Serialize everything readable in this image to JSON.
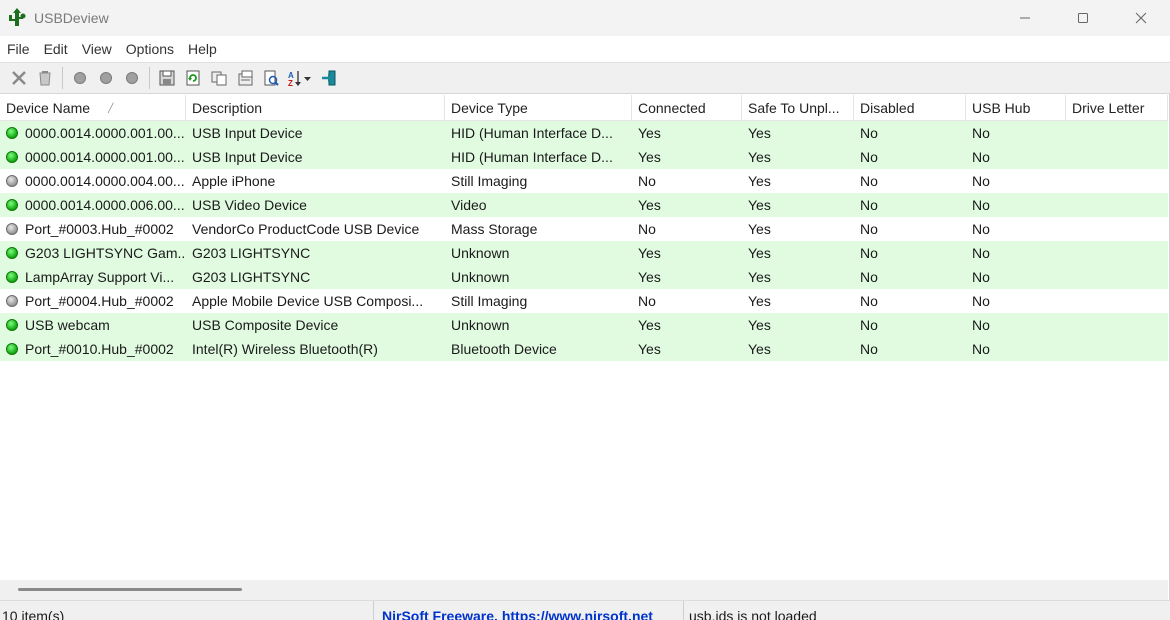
{
  "window": {
    "title": "USBDeview"
  },
  "menu": [
    "File",
    "Edit",
    "View",
    "Options",
    "Help"
  ],
  "toolbar": {
    "icons": [
      "uninstall-icon",
      "disconnect-icon",
      "disable-icon",
      "enable-icon",
      "reconnect-icon",
      "save-icon",
      "refresh-icon",
      "copy-icon",
      "properties-icon",
      "html-report-icon",
      "sort-icon",
      "exit-icon"
    ]
  },
  "columns": [
    "Device Name",
    "Description",
    "Device Type",
    "Connected",
    "Safe To Unpl...",
    "Disabled",
    "USB Hub",
    "Drive Letter"
  ],
  "rows": [
    {
      "name": "0000.0014.0000.001.00...",
      "description": "USB Input Device",
      "type": "HID (Human Interface D...",
      "connected": "Yes",
      "safe": "Yes",
      "disabled": "No",
      "hub": "No",
      "drive": ""
    },
    {
      "name": "0000.0014.0000.001.00...",
      "description": "USB Input Device",
      "type": "HID (Human Interface D...",
      "connected": "Yes",
      "safe": "Yes",
      "disabled": "No",
      "hub": "No",
      "drive": ""
    },
    {
      "name": "0000.0014.0000.004.00...",
      "description": "Apple iPhone",
      "type": "Still Imaging",
      "connected": "No",
      "safe": "Yes",
      "disabled": "No",
      "hub": "No",
      "drive": ""
    },
    {
      "name": "0000.0014.0000.006.00...",
      "description": "USB Video Device",
      "type": "Video",
      "connected": "Yes",
      "safe": "Yes",
      "disabled": "No",
      "hub": "No",
      "drive": ""
    },
    {
      "name": "Port_#0003.Hub_#0002",
      "description": "VendorCo ProductCode USB Device",
      "type": "Mass Storage",
      "connected": "No",
      "safe": "Yes",
      "disabled": "No",
      "hub": "No",
      "drive": ""
    },
    {
      "name": "G203 LIGHTSYNC Gam...",
      "description": "G203 LIGHTSYNC",
      "type": "Unknown",
      "connected": "Yes",
      "safe": "Yes",
      "disabled": "No",
      "hub": "No",
      "drive": ""
    },
    {
      "name": "LampArray Support Vi...",
      "description": "G203 LIGHTSYNC",
      "type": "Unknown",
      "connected": "Yes",
      "safe": "Yes",
      "disabled": "No",
      "hub": "No",
      "drive": ""
    },
    {
      "name": "Port_#0004.Hub_#0002",
      "description": "Apple Mobile Device USB Composi...",
      "type": "Still Imaging",
      "connected": "No",
      "safe": "Yes",
      "disabled": "No",
      "hub": "No",
      "drive": ""
    },
    {
      "name": "USB webcam",
      "description": "USB Composite Device",
      "type": "Unknown",
      "connected": "Yes",
      "safe": "Yes",
      "disabled": "No",
      "hub": "No",
      "drive": ""
    },
    {
      "name": "Port_#0010.Hub_#0002",
      "description": "Intel(R) Wireless Bluetooth(R)",
      "type": "Bluetooth Device",
      "connected": "Yes",
      "safe": "Yes",
      "disabled": "No",
      "hub": "No",
      "drive": ""
    }
  ],
  "status": {
    "count": "10 item(s)",
    "link": "NirSoft Freeware.  https://www.nirsoft.net",
    "message": "usb.ids is not loaded"
  },
  "colors": {
    "connected_row": "#e1fbe1",
    "connected_dot": "#1db31d",
    "disconnected_dot": "#a0a0a0",
    "link": "#0033cc"
  }
}
